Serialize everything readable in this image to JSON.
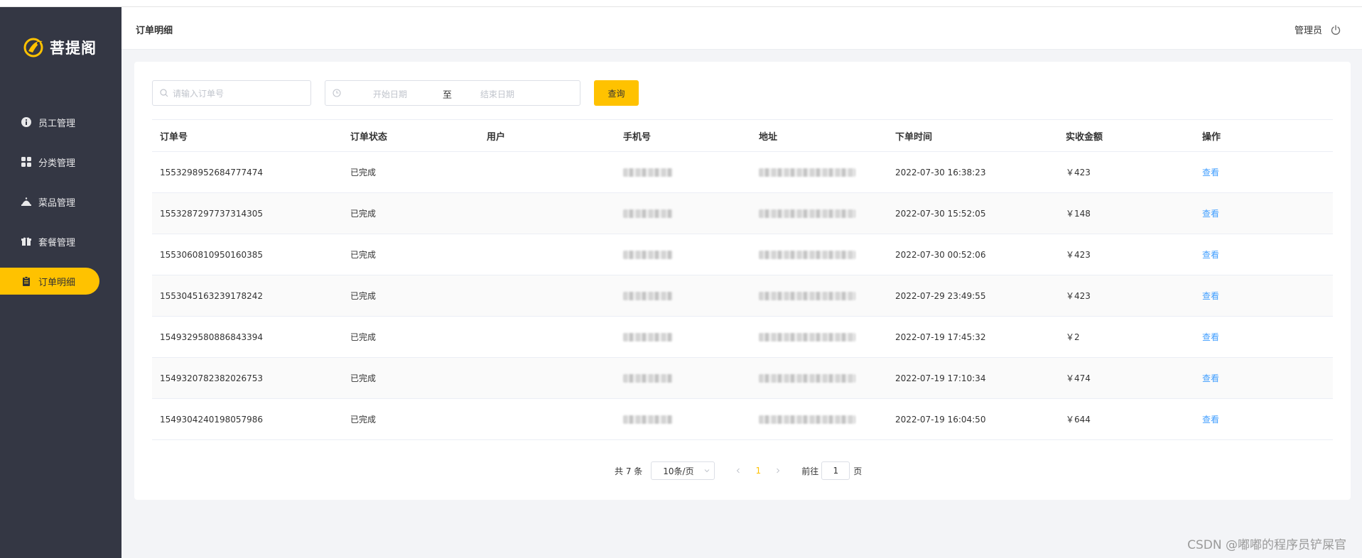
{
  "app": {
    "logo_text": "菩提阁",
    "page_title": "订单明细",
    "user_label": "管理员"
  },
  "sidebar": {
    "items": [
      {
        "label": "员工管理",
        "icon": "info-circle-icon",
        "active": false
      },
      {
        "label": "分类管理",
        "icon": "grid-icon",
        "active": false
      },
      {
        "label": "菜品管理",
        "icon": "dish-cover-icon",
        "active": false
      },
      {
        "label": "套餐管理",
        "icon": "gift-icon",
        "active": false
      },
      {
        "label": "订单明细",
        "icon": "clipboard-icon",
        "active": true
      }
    ]
  },
  "filter": {
    "order_placeholder": "请输入订单号",
    "start_placeholder": "开始日期",
    "range_separator": "至",
    "end_placeholder": "结束日期",
    "query_label": "查询"
  },
  "table": {
    "headers": [
      "订单号",
      "订单状态",
      "用户",
      "手机号",
      "地址",
      "下单时间",
      "实收金额",
      "操作"
    ],
    "rows": [
      {
        "order_no": "1553298952684777474",
        "status": "已完成",
        "user": "",
        "time": "2022-07-30 16:38:23",
        "amount": "￥423",
        "action": "查看"
      },
      {
        "order_no": "1553287297737314305",
        "status": "已完成",
        "user": "",
        "time": "2022-07-30 15:52:05",
        "amount": "￥148",
        "action": "查看"
      },
      {
        "order_no": "1553060810950160385",
        "status": "已完成",
        "user": "",
        "time": "2022-07-30 00:52:06",
        "amount": "￥423",
        "action": "查看"
      },
      {
        "order_no": "1553045163239178242",
        "status": "已完成",
        "user": "",
        "time": "2022-07-29 23:49:55",
        "amount": "￥423",
        "action": "查看"
      },
      {
        "order_no": "1549329580886843394",
        "status": "已完成",
        "user": "",
        "time": "2022-07-19 17:45:32",
        "amount": "￥2",
        "action": "查看"
      },
      {
        "order_no": "1549320782382026753",
        "status": "已完成",
        "user": "",
        "time": "2022-07-19 17:10:34",
        "amount": "￥474",
        "action": "查看"
      },
      {
        "order_no": "1549304240198057986",
        "status": "已完成",
        "user": "",
        "time": "2022-07-19 16:04:50",
        "amount": "￥644",
        "action": "查看"
      }
    ]
  },
  "pagination": {
    "total": "共 7 条",
    "page_size": "10条/页",
    "current_page": "1",
    "goto_prefix": "前往",
    "goto_value": "1",
    "goto_suffix": "页"
  },
  "watermark": "CSDN @嘟嘟的程序员铲屎官",
  "colors": {
    "sidebar_bg": "#343744",
    "accent": "#ffc200",
    "link": "#409eff"
  }
}
